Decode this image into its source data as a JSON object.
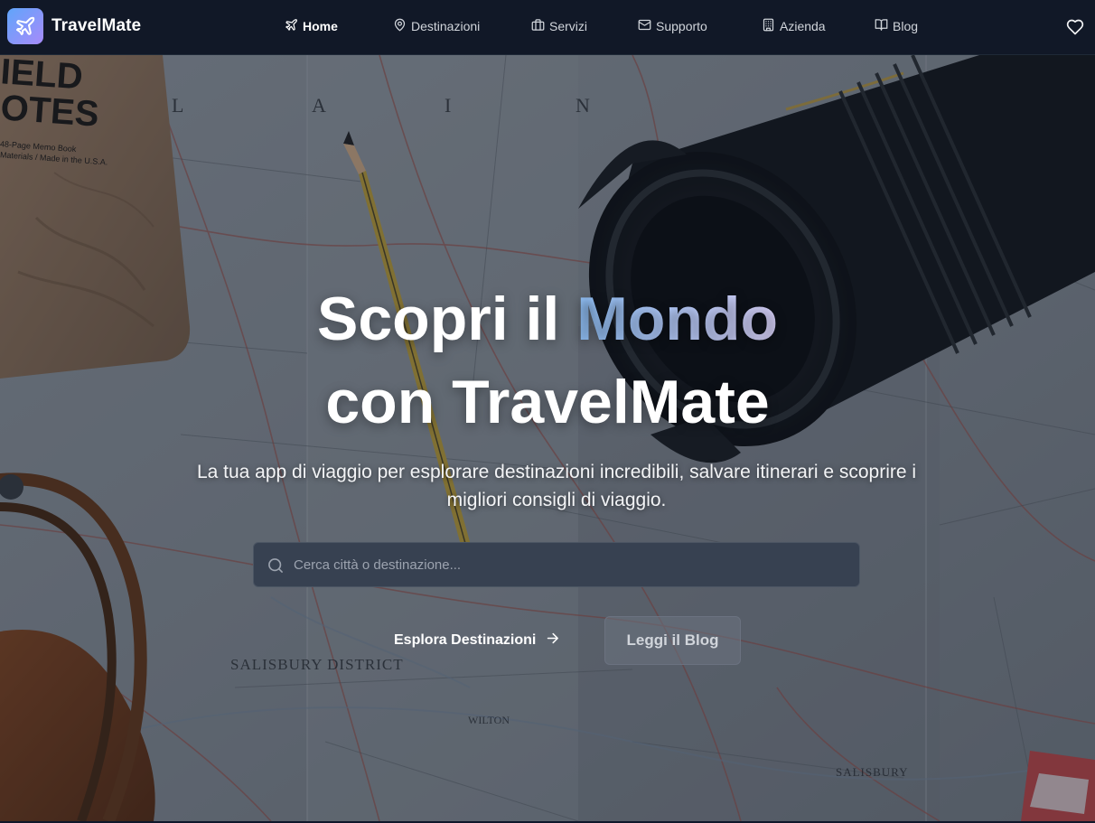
{
  "brand": {
    "name": "TravelMate",
    "logo_icon": "plane-icon"
  },
  "nav": {
    "items": [
      {
        "label": "Home",
        "icon": "plane-icon",
        "active": true
      },
      {
        "label": "Destinazioni",
        "icon": "map-pin-icon",
        "active": false
      },
      {
        "label": "Servizi",
        "icon": "briefcase-icon",
        "active": false
      },
      {
        "label": "Supporto",
        "icon": "mail-icon",
        "active": false
      },
      {
        "label": "Azienda",
        "icon": "building-icon",
        "active": false
      },
      {
        "label": "Blog",
        "icon": "book-open-icon",
        "active": false
      }
    ],
    "favorites_icon": "heart-icon"
  },
  "hero": {
    "title_line1_start": "Scopri il ",
    "title_accent": "Mondo",
    "title_line2": "con TravelMate",
    "subtitle": "La tua app di viaggio per esplorare destinazioni incredibili, salvare itinerari e scoprire i migliori consigli di viaggio.",
    "search": {
      "placeholder": "Cerca città o destinazione...",
      "value": ""
    },
    "primary_button": "Esplora Destinazioni",
    "secondary_button": "Leggi il Blog",
    "background_text": {
      "notebook_line1": "IELD",
      "notebook_line2": "OTES",
      "notebook_small": "48-Page Memo Book",
      "notebook_small2": "Materials / Made in the U.S.A.",
      "map_letters": [
        "A",
        "I",
        "N",
        "L"
      ],
      "district": "SALISBURY  DISTRICT",
      "wilton": "WILTON",
      "salisbury": "SALISBURY"
    }
  },
  "colors": {
    "navbar_bg": "#111827",
    "accent_from": "#93c5fd",
    "accent_to": "#ddd6fe",
    "search_bg": "#374151"
  }
}
